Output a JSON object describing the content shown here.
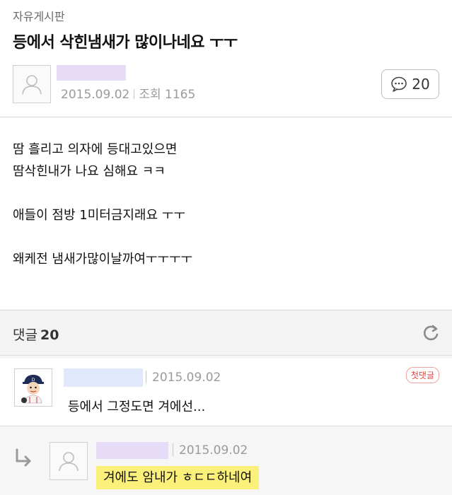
{
  "board": {
    "name": "자유게시판"
  },
  "post": {
    "title": "등에서 삭힌냄새가 많이나네요 ㅜㅜ",
    "date": "2015.09.02",
    "views_label": "조회",
    "views": "1165",
    "comment_count": "20",
    "body": [
      "땀 흘리고 의자에 등대고있으면",
      "땀삭힌내가 나요 심해요 ㅋㅋ",
      "",
      "애들이 점방 1미터금지래요 ㅜㅜ",
      "",
      "왜케전 냄새가많이날까여ㅜㅜㅜㅜ"
    ]
  },
  "comments": {
    "header_label": "댓글",
    "count": "20",
    "items": [
      {
        "date": "2015.09.02",
        "text": "등에서 그정도면 겨에선...",
        "badge": "첫댓글"
      },
      {
        "date": "2015.09.02",
        "text": "겨에도 암내가 ㅎㄷㄷ하네여"
      }
    ]
  },
  "colors": {
    "accent_badge": "#e8443a",
    "name_mask_purple": "#e6dcf8",
    "name_mask_blue": "#dfe9fb",
    "highlight": "#fbf07a"
  },
  "icons": [
    "person-placeholder-icon",
    "speech-bubble-icon",
    "refresh-icon",
    "reply-arrow-icon"
  ]
}
